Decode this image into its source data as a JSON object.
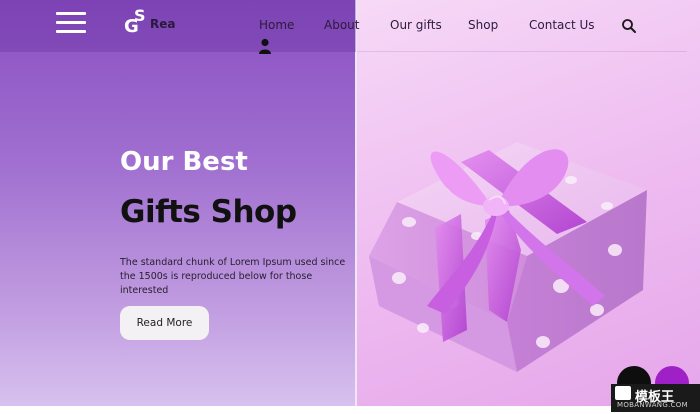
{
  "brand": {
    "logo_mark": "GS",
    "logo_text": "Rea"
  },
  "nav": {
    "items": [
      {
        "label": "Home"
      },
      {
        "label": "About"
      },
      {
        "label": "Our gifts"
      },
      {
        "label": "Shop"
      },
      {
        "label": "Contact Us"
      }
    ],
    "icons": [
      "menu-icon",
      "search-icon",
      "user-icon"
    ]
  },
  "hero": {
    "line1": "Our Best",
    "line2": "Gifts Shop",
    "description": "The standard chunk of Lorem Ipsum used since the 1500s is reproduced below for those interested",
    "button_label": "Read More"
  },
  "watermark": {
    "title": "模板王",
    "url": "MOBANWANG.COM"
  },
  "colors": {
    "left_panel": "#9a62cc",
    "right_panel": "#f0c6f2",
    "heading_light": "#ffffff",
    "heading_dark": "#111111",
    "accent_circle": "#a020c8"
  }
}
